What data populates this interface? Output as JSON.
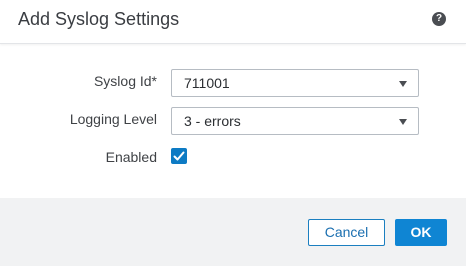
{
  "dialog": {
    "title": "Add Syslog Settings",
    "help_icon": "question-circle-icon"
  },
  "form": {
    "syslog_id": {
      "label": "Syslog Id*",
      "value": "711001"
    },
    "logging_level": {
      "label": "Logging Level",
      "value": "3 - errors"
    },
    "enabled": {
      "label": "Enabled",
      "checked": true
    }
  },
  "footer": {
    "cancel_label": "Cancel",
    "ok_label": "OK"
  },
  "colors": {
    "primary": "#0f85d3",
    "footer_bg": "#f1f2f3"
  }
}
